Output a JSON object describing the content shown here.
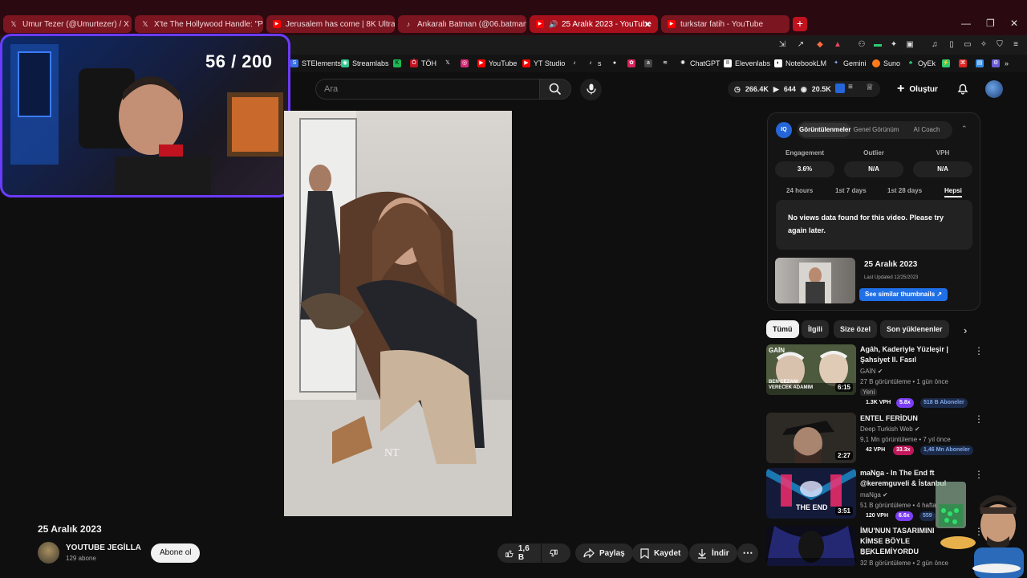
{
  "browser": {
    "tabs": [
      {
        "label": "Umur Tezer (@Umurtezer) / X",
        "icon": "x-icon"
      },
      {
        "label": "X'te The Hollywood Handle: \"PROJE",
        "icon": "x-icon"
      },
      {
        "label": "Jerusalem has come | 8K Ultra HD Ci",
        "icon": "youtube-icon"
      },
      {
        "label": "Ankaralı Batman (@06.batmann) | Tik",
        "icon": "tiktok-icon"
      },
      {
        "label": "25 Aralık 2023 - YouTube",
        "icon": "youtube-icon",
        "active": true
      },
      {
        "label": "turkstar fatih - YouTube",
        "icon": "youtube-icon"
      }
    ],
    "bookmarks": [
      "STElements",
      "Streamlabs",
      "TÖH",
      "YouTube",
      "YT Studio",
      "s",
      "ChatGPT",
      "Elevenlabs",
      "NotebookLM",
      "Gemini",
      "Suno",
      "OyEk"
    ]
  },
  "overlay": {
    "counter": "56 / 200"
  },
  "header": {
    "search_placeholder": "Ara",
    "stats": {
      "views": "266.4K",
      "videos": "644",
      "watch": "20.5K"
    },
    "create_label": "Oluştur"
  },
  "video": {
    "title": "25 Aralık 2023",
    "channel": "YOUTUBE JEGİLLA",
    "subscribers": "129 abone",
    "subscribe_label": "Abone ol",
    "likes": "1,6 B",
    "share_label": "Paylaş",
    "save_label": "Kaydet",
    "download_label": "İndir"
  },
  "vidiq": {
    "logo": "IQ",
    "tabs": [
      "Görüntülenmeler",
      "Genel Görünüm",
      "AI Coach"
    ],
    "metrics": [
      {
        "label": "Engagement",
        "value": "3.6%"
      },
      {
        "label": "Outlier",
        "value": "N/A"
      },
      {
        "label": "VPH",
        "value": "N/A"
      }
    ],
    "ranges": [
      "24 hours",
      "1st 7 days",
      "1st 28 days",
      "Hepsi"
    ],
    "no_data": "No views data found for this video. Please try again later.",
    "similar_title": "25 Aralık 2023",
    "last_updated": "Last Updated 12/25/2023",
    "similar_button": "See similar thumbnails ↗"
  },
  "chips": [
    "Tümü",
    "İlgili",
    "Size özel",
    "Son yüklenenler"
  ],
  "recommendations": [
    {
      "title": "Agâh, Kaderiyle Yüzleşir | Şahsiyet II. Fasıl",
      "channel": "GAİN",
      "meta": "27 B görüntüleme • 1 gün önce",
      "new": "Yeni",
      "duration": "6:15",
      "vph": "1.3K VPH",
      "mult": "5.8x",
      "subs": "518 B Aboneler"
    },
    {
      "title": "ENTEL FERİDUN",
      "channel": "Deep Turkish Web",
      "meta": "9,1 Mn görüntüleme • 7 yıl önce",
      "duration": "2:27",
      "vph": "42 VPH",
      "mult": "33.3x",
      "subs": "1,46 Mn Aboneler"
    },
    {
      "title": "maNga - In The End ft @keremguveli & İstanbul",
      "channel": "maNga",
      "meta": "51 B görüntüleme • 4 hafta",
      "duration": "3:51",
      "vph": "120 VPH",
      "mult": "6.6x",
      "subs": "559"
    },
    {
      "title": "İMU'NUN TASARIMINI KİMSE BÖYLE BEKLEMİYORDU",
      "channel": "GLY",
      "meta": "32 B görüntüleme • 2 gün önce",
      "duration": ""
    }
  ],
  "thumb_text": {
    "gain_logo": "GAİN",
    "gain_caption": "BEN CEZANI VERECEK ADAMIM",
    "manga_caption": "THE END"
  },
  "colors": {
    "accent_red": "#ff0000",
    "vidiq_blue": "#1f6fe6",
    "webcam_border": "#6b3bff"
  }
}
